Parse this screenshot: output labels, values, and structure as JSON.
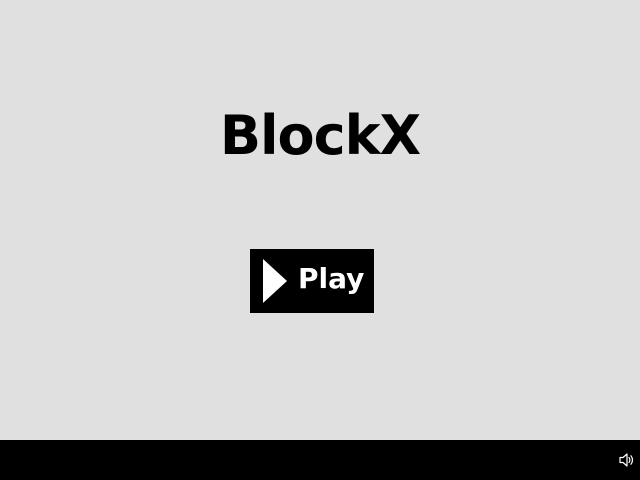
{
  "game": {
    "title": "BlockX",
    "play_button": {
      "label": "Play",
      "icon": "play-icon"
    },
    "sound_toggle": {
      "icon": "speaker-icon",
      "state": "on"
    }
  },
  "colors": {
    "background": "#e0e0e0",
    "title_text": "#000000",
    "button_bg": "#000000",
    "button_text": "#ffffff",
    "bottom_bar": "#000000"
  }
}
